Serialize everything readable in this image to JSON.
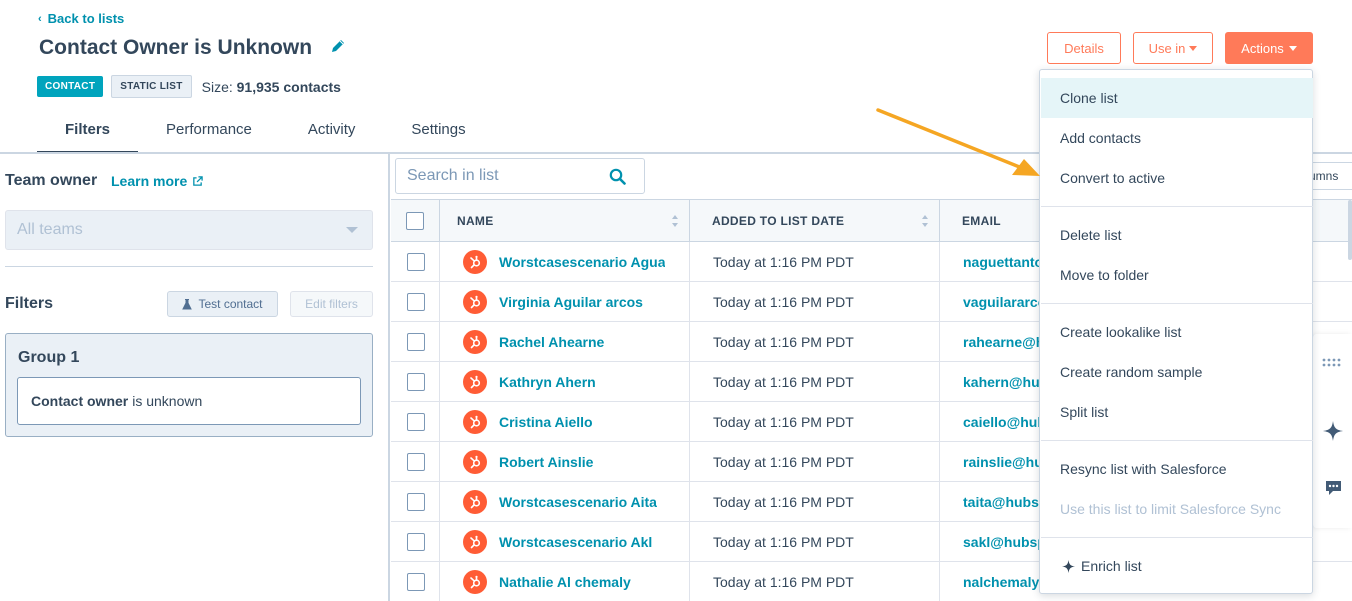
{
  "header": {
    "back_link": "Back to lists",
    "title": "Contact Owner is Unknown",
    "badge_contact": "CONTACT",
    "badge_static": "STATIC LIST",
    "size_label": "Size:",
    "size_value": "91,935 contacts",
    "details_button": "Details",
    "use_in_button": "Use in",
    "actions_button": "Actions"
  },
  "tabs": [
    {
      "label": "Filters",
      "active": true
    },
    {
      "label": "Performance",
      "active": false
    },
    {
      "label": "Activity",
      "active": false
    },
    {
      "label": "Settings",
      "active": false
    }
  ],
  "left_panel": {
    "team_owner_label": "Team owner",
    "learn_more": "Learn more",
    "teams_select_value": "All teams",
    "filters_label": "Filters",
    "test_contact_button": "Test contact",
    "edit_filters_button": "Edit filters",
    "group_title": "Group 1",
    "condition_property": "Contact owner",
    "condition_operator": "is unknown"
  },
  "table": {
    "search_placeholder": "Search in list",
    "columns_button_partial": "umns",
    "headers": {
      "name": "NAME",
      "added_date": "ADDED TO LIST DATE",
      "email": "EMAIL"
    },
    "rows": [
      {
        "name": "Worstcasescenario Aguayo",
        "date": "Today at 1:16 PM PDT",
        "email": "naguettantoine@hubspot.com"
      },
      {
        "name": "Virginia Aguilar arcos",
        "date": "Today at 1:16 PM PDT",
        "email": "vaguilararcos@hubspot.com"
      },
      {
        "name": "Rachel Ahearne",
        "date": "Today at 1:16 PM PDT",
        "email": "rahearne@hubspot.com"
      },
      {
        "name": "Kathryn Ahern",
        "date": "Today at 1:16 PM PDT",
        "email": "kahern@hubspot.com"
      },
      {
        "name": "Cristina Aiello",
        "date": "Today at 1:16 PM PDT",
        "email": "caiello@hubspot.com"
      },
      {
        "name": "Robert Ainslie",
        "date": "Today at 1:16 PM PDT",
        "email": "rainslie@hubspot.com"
      },
      {
        "name": "Worstcasescenario Aita",
        "date": "Today at 1:16 PM PDT",
        "email": "taita@hubspot.com"
      },
      {
        "name": "Worstcasescenario Akl",
        "date": "Today at 1:16 PM PDT",
        "email": "sakl@hubspot.com"
      },
      {
        "name": "Nathalie Al chemaly",
        "date": "Today at 1:16 PM PDT",
        "email": "nalchemaly@hubspot.com"
      }
    ]
  },
  "actions_menu": {
    "items": [
      {
        "label": "Clone list",
        "state": "hover"
      },
      {
        "label": "Add contacts",
        "state": "normal"
      },
      {
        "label": "Convert to active",
        "state": "normal"
      },
      {
        "label": "Delete list",
        "state": "normal"
      },
      {
        "label": "Move to folder",
        "state": "normal"
      },
      {
        "label": "Create lookalike list",
        "state": "normal"
      },
      {
        "label": "Create random sample",
        "state": "normal"
      },
      {
        "label": "Split list",
        "state": "normal"
      },
      {
        "label": "Resync list with Salesforce",
        "state": "normal"
      },
      {
        "label": "Use this list to limit Salesforce Sync",
        "state": "disabled"
      },
      {
        "label": "Enrich list",
        "state": "normal"
      }
    ]
  },
  "colors": {
    "accent_orange": "#ff7a59",
    "link_teal": "#0091ae",
    "text_dark": "#33475b",
    "annotation_arrow": "#f5a623"
  }
}
